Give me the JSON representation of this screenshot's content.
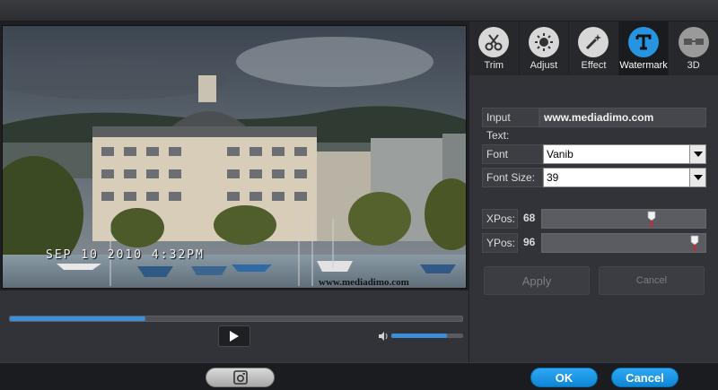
{
  "video": {
    "timestamp": "SEP 10 2010   4:32PM",
    "watermark_text": "www.mediadimo.com",
    "progress_percent": 30,
    "volume_percent": 78
  },
  "tabs": [
    {
      "label": "Trim",
      "icon": "scissors-icon"
    },
    {
      "label": "Adjust",
      "icon": "brightness-icon"
    },
    {
      "label": "Effect",
      "icon": "magic-wand-icon"
    },
    {
      "label": "Watermark",
      "icon": "text-t-icon",
      "active": true
    },
    {
      "label": "3D",
      "icon": "3d-glasses-icon"
    }
  ],
  "watermark": {
    "input_text_label": "Input Text:",
    "input_text_value": "www.mediadimo.com",
    "font_name_label": "Font Name:",
    "font_name_value": "Vanib",
    "font_size_label": "Font Size:",
    "font_size_value": "39",
    "xpos_label": "XPos:",
    "xpos_value": "68",
    "ypos_label": "YPos:",
    "ypos_value": "96",
    "apply_label": "Apply",
    "cancel_label": "Cancel"
  },
  "footer": {
    "ok_label": "OK",
    "cancel_label": "Cancel"
  },
  "colors": {
    "accent": "#2694e0",
    "button_blue": "#0d86d6",
    "slider_marker": "#e02020"
  }
}
